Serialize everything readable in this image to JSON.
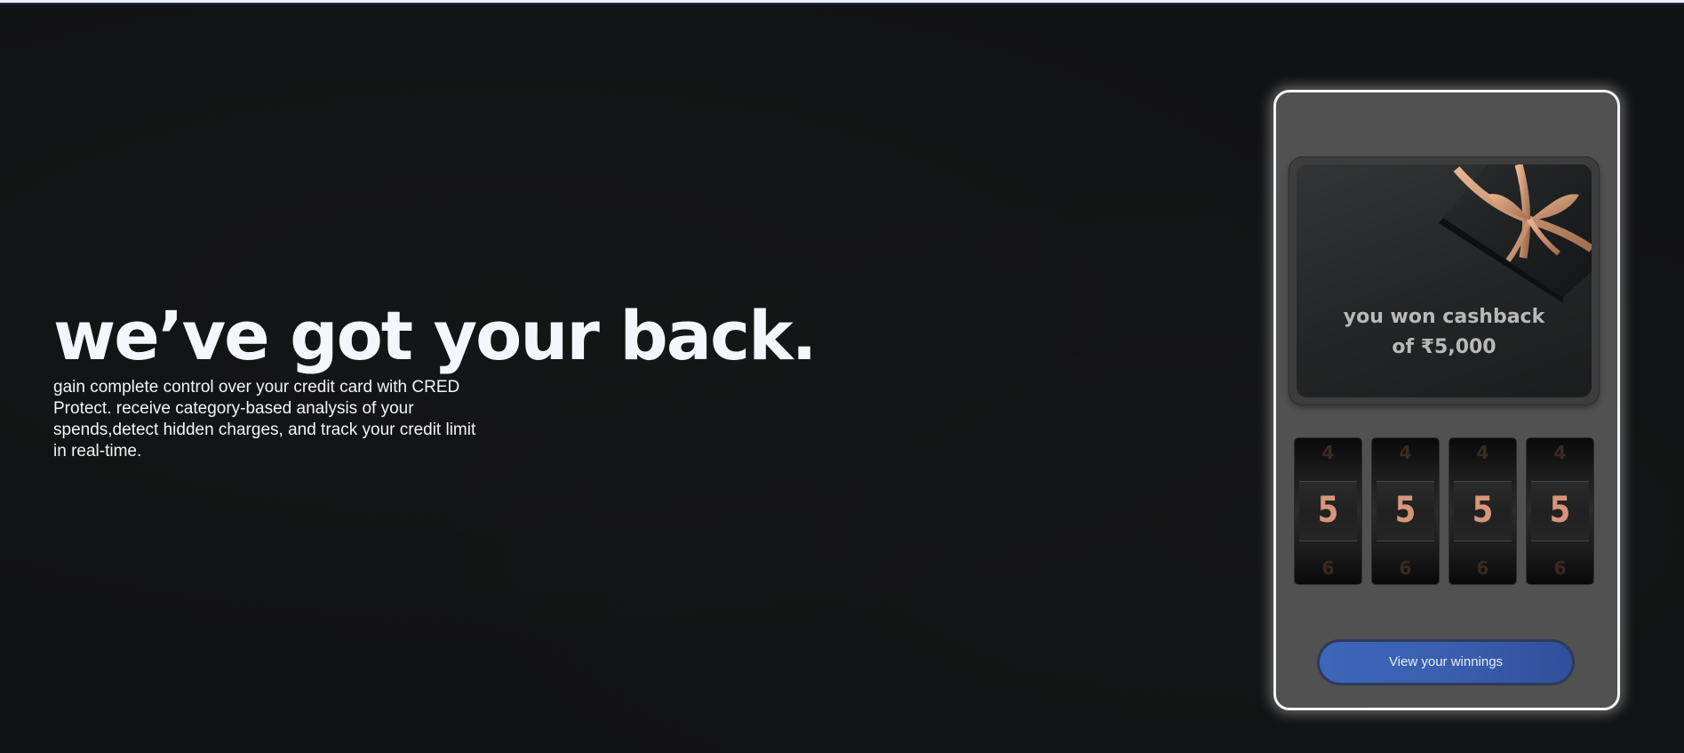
{
  "hero": {
    "headline": "we’ve got your back.",
    "description": "gain complete control over your credit card with CRED Protect. receive category-based analysis of your spends,detect hidden charges, and track your credit limit in real-time."
  },
  "reward_card": {
    "line1": "you won cashback",
    "line2": "of ₹5,000"
  },
  "reels": [
    {
      "above": "4",
      "current": "5",
      "below": "6"
    },
    {
      "above": "4",
      "current": "5",
      "below": "6"
    },
    {
      "above": "4",
      "current": "5",
      "below": "6"
    },
    {
      "above": "4",
      "current": "5",
      "below": "6"
    }
  ],
  "cta": {
    "label": "View your winnings"
  },
  "colors": {
    "background": "#111213",
    "headline": "#f3f6fc",
    "phone_card": "#515151",
    "digit": "#d7957a",
    "button": "#3d66b8"
  }
}
